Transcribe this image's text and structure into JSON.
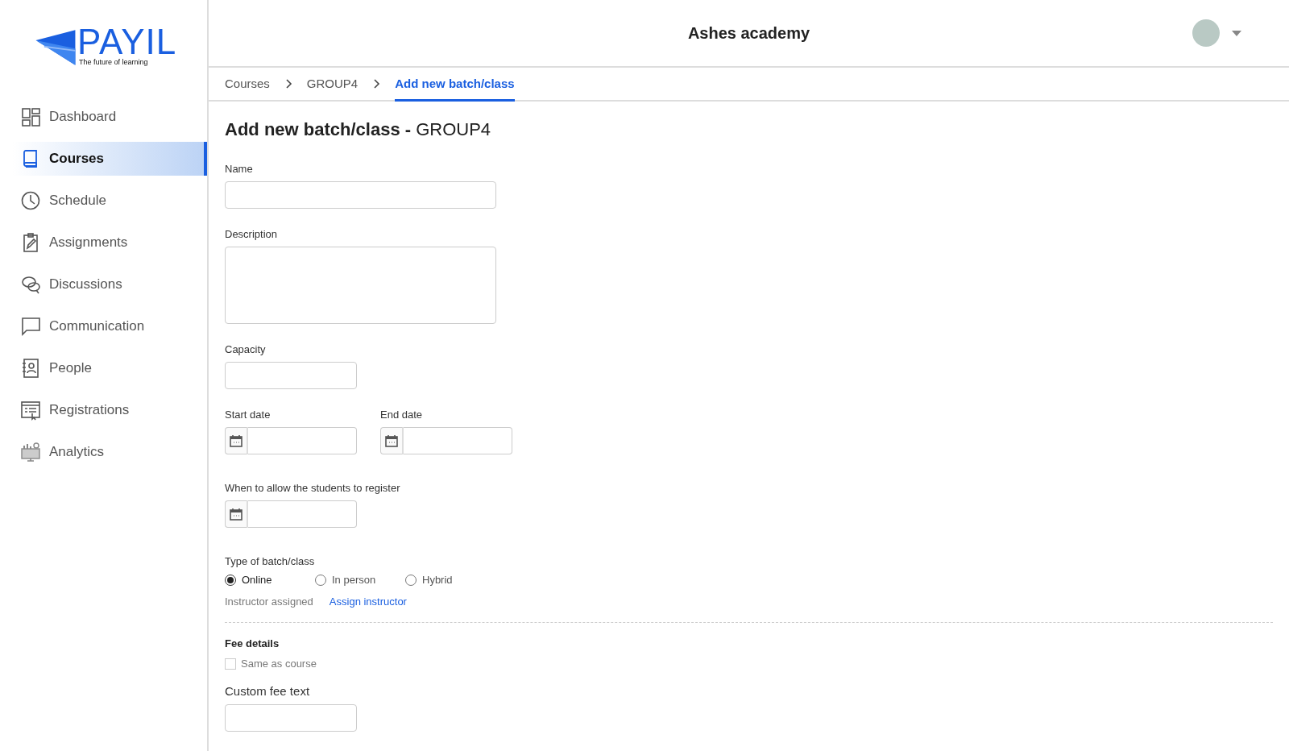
{
  "logo": {
    "name": "PAYIL",
    "tagline": "The future of learning"
  },
  "sidebar": {
    "items": [
      {
        "label": "Dashboard",
        "selected": false
      },
      {
        "label": "Courses",
        "selected": true
      },
      {
        "label": "Schedule",
        "selected": false
      },
      {
        "label": "Assignments",
        "selected": false
      },
      {
        "label": "Discussions",
        "selected": false
      },
      {
        "label": "Communication",
        "selected": false
      },
      {
        "label": "People",
        "selected": false
      },
      {
        "label": "Registrations",
        "selected": false
      },
      {
        "label": "Analytics",
        "selected": false
      }
    ]
  },
  "header": {
    "title": "Ashes academy"
  },
  "breadcrumbs": [
    {
      "label": "Courses",
      "selected": false
    },
    {
      "label": "GROUP4",
      "selected": false
    },
    {
      "label": "Add new batch/class",
      "selected": true
    }
  ],
  "page_title": "**Add new batch/class -** GROUP4",
  "fields": [
    {
      "kind": "text",
      "label": "Name"
    },
    {
      "kind": "textarea",
      "label": "Description"
    },
    {
      "kind": "short",
      "label": "Capacity"
    },
    {
      "kind": "dates",
      "items": [
        {
          "label": "Start date"
        },
        {
          "label": "End date"
        }
      ]
    },
    {
      "kind": "dates",
      "items": [
        {
          "label": "When to allow the students to register"
        }
      ]
    }
  ],
  "batch_type": {
    "label": "Type of batch/class",
    "options": [
      {
        "label": "Online",
        "selected": true
      },
      {
        "label": "In person",
        "selected": false
      },
      {
        "label": "Hybrid",
        "selected": false
      }
    ]
  },
  "instructor": {
    "label": "Instructor assigned",
    "link": "Assign instructor"
  },
  "fee": {
    "title": "Fee details",
    "same_as_course": {
      "label": "Same as course",
      "checked": false
    },
    "custom_label": "Custom fee text"
  }
}
